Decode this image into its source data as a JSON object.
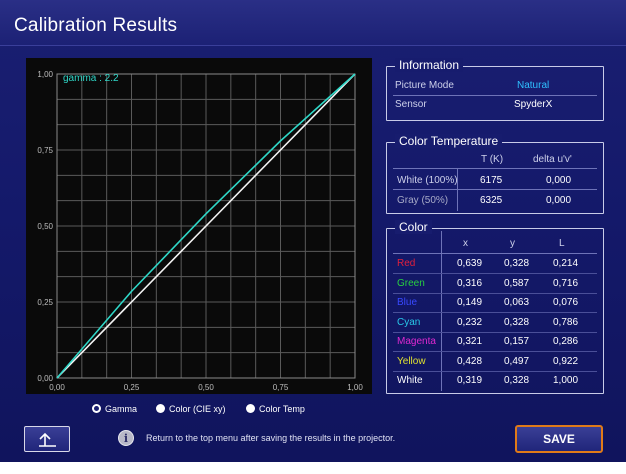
{
  "window": {
    "title": "Calibration Results"
  },
  "chart_data": {
    "type": "line",
    "annotation": "gamma : 2.2",
    "xlim": [
      0,
      1
    ],
    "ylim": [
      0,
      1
    ],
    "x_ticks": [
      "0,00",
      "0,25",
      "0,50",
      "0,75",
      "1,00"
    ],
    "y_ticks": [
      "0,00",
      "0,25",
      "0,50",
      "0,75",
      "1,00"
    ],
    "grid": true,
    "series": [
      {
        "color": "#f4f4f4",
        "x": [
          0,
          0.25,
          0.5,
          0.75,
          1.0
        ],
        "y": [
          0,
          0.25,
          0.5,
          0.75,
          1.0
        ]
      },
      {
        "color": "#2fd8c8",
        "x": [
          0,
          0.25,
          0.5,
          0.75,
          1.0
        ],
        "y": [
          0,
          0.285,
          0.54,
          0.78,
          1.0
        ]
      }
    ]
  },
  "information": {
    "title": "Information",
    "rows": [
      {
        "label": "Picture Mode",
        "value": "Natural"
      },
      {
        "label": "Sensor",
        "value": "SpyderX"
      }
    ]
  },
  "color_temperature": {
    "title": "Color Temperature",
    "headers": [
      "T (K)",
      "delta u'v'"
    ],
    "rows": [
      {
        "label": "White (100%)",
        "t": "6175",
        "delta": "0,000"
      },
      {
        "label": "Gray (50%)",
        "t": "6325",
        "delta": "0,000"
      }
    ]
  },
  "color": {
    "title": "Color",
    "headers": [
      "x",
      "y",
      "L"
    ],
    "rows": [
      {
        "label": "Red",
        "color": "#e0203c",
        "x": "0,639",
        "y": "0,328",
        "l": "0,214"
      },
      {
        "label": "Green",
        "color": "#28d040",
        "x": "0,316",
        "y": "0,587",
        "l": "0,716"
      },
      {
        "label": "Blue",
        "color": "#3848ff",
        "x": "0,149",
        "y": "0,063",
        "l": "0,076"
      },
      {
        "label": "Cyan",
        "color": "#28c8e8",
        "x": "0,232",
        "y": "0,328",
        "l": "0,786"
      },
      {
        "label": "Magenta",
        "color": "#e028d0",
        "x": "0,321",
        "y": "0,157",
        "l": "0,286"
      },
      {
        "label": "Yellow",
        "color": "#e0e030",
        "x": "0,428",
        "y": "0,497",
        "l": "0,922"
      },
      {
        "label": "White",
        "color": "#ffffff",
        "x": "0,319",
        "y": "0,328",
        "l": "1,000"
      }
    ]
  },
  "tabs": [
    {
      "label": "Gamma",
      "selected": true
    },
    {
      "label": "Color (CIE xy)",
      "selected": false
    },
    {
      "label": "Color Temp",
      "selected": false
    }
  ],
  "footer": {
    "back_icon": "return-arrow-icon",
    "info_glyph": "i",
    "hint": "Return to the top menu after saving the results in the projector.",
    "save_label": "SAVE"
  },
  "colors": {
    "accent": "#2fc0ff",
    "save_border": "#e07a18"
  }
}
